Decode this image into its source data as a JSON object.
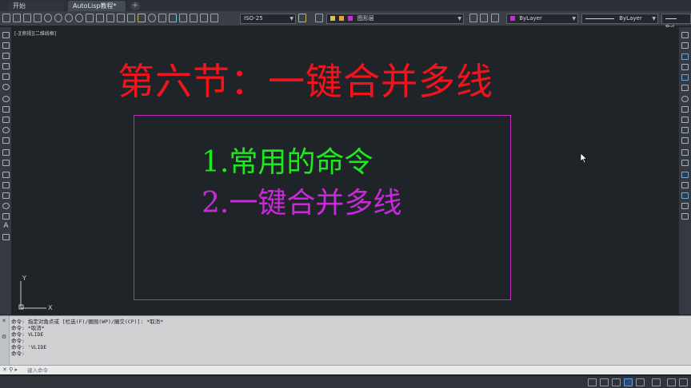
{
  "tabs": {
    "start": "开始",
    "active": "AutoLisp教程*",
    "add": "+"
  },
  "toolbar": {
    "dimstyle": "ISO-25",
    "layer": "图形层",
    "color": "ByLayer",
    "linetype": "ByLayer",
    "lineweight": "ByL"
  },
  "canvas": {
    "viewport_label": "[-][俯视][二维线框]",
    "heading": "第六节：一键合并多线",
    "item1": "1.常用的命令",
    "item2": "2.一键合并多线",
    "ucs_y": "Y",
    "ucs_x": "X"
  },
  "command": {
    "history": [
      "命令: 指定对角点或 [栏选(F)/圈围(WP)/圈交(CP)]: *取消*",
      "命令: *取消*",
      "命令: VLIDE",
      "命令:",
      "命令: 'VLIDE",
      "命令:"
    ],
    "placeholder": "键入命令"
  },
  "colors": {
    "heading": "#f2141c",
    "item1": "#1ee81e",
    "item2": "#c82ad8",
    "frame": "#c428c4",
    "canvas": "#1f2429"
  }
}
